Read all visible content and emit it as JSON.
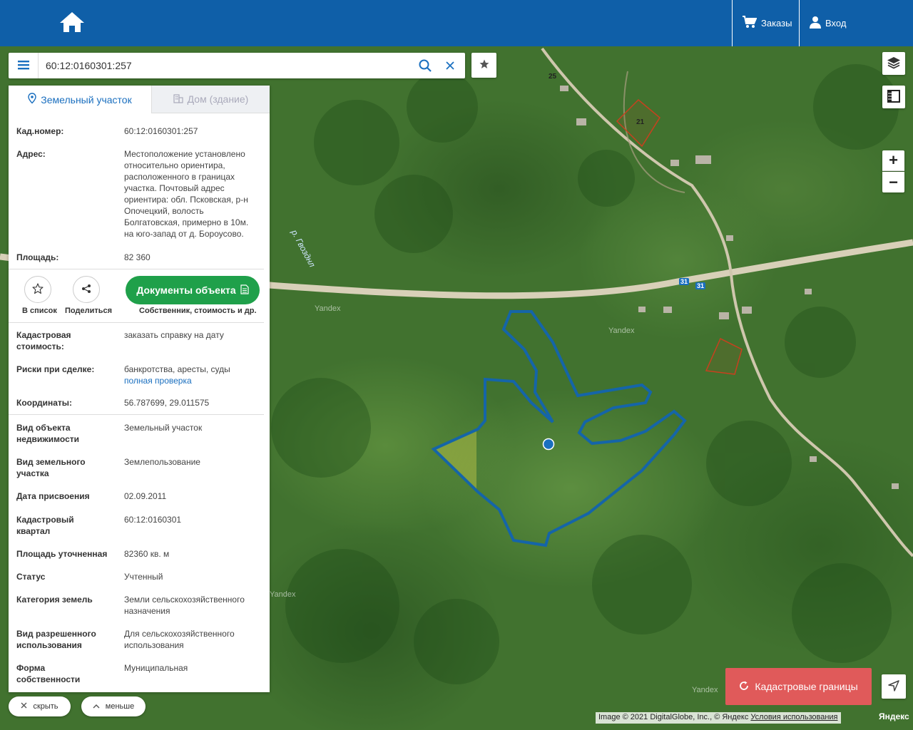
{
  "header": {
    "home_icon": "home-icon",
    "orders_label": "Заказы",
    "login_label": "Вход",
    "bg_color": "#0f5fa8"
  },
  "search": {
    "value": "60:12:0160301:257"
  },
  "panel": {
    "tabs": [
      {
        "label": "Земельный участок",
        "icon": "map-pin-icon",
        "active": true
      },
      {
        "label": "Дом (здание)",
        "icon": "building-icon",
        "active": false
      }
    ],
    "cad_number": {
      "label": "Кад.номер:",
      "value": "60:12:0160301:257"
    },
    "address": {
      "label": "Адрес:",
      "lines": [
        "Местоположение установлено",
        "относительно ориентира,",
        "расположенного в границах",
        "участка. Почтовый адрес",
        "ориентира: обл. Псковская, р-н",
        "Опочецкий, волость",
        "Болгатовская, примерно в 10м.",
        "на юго-запад от д. Бороусово."
      ]
    },
    "area": {
      "label": "Площадь:",
      "value": "82 360"
    },
    "actions": {
      "add_to_list": "В список",
      "share": "Поделиться",
      "documents": "Документы объекта",
      "documents_sub": "Собственник, стоимость и др."
    },
    "cad_cost": {
      "label_lines": [
        "Кадастровая",
        "стоимость:"
      ],
      "value": "заказать справку на дату"
    },
    "risks": {
      "label": "Риски при сделке:",
      "value": "банкротства, аресты, суды",
      "link": "полная проверка"
    },
    "coords": {
      "label": "Координаты:",
      "value": "56.787699, 29.011575"
    },
    "details": [
      {
        "label_lines": [
          "Вид объекта",
          "недвижимости"
        ],
        "value_lines": [
          "Земельный участок"
        ]
      },
      {
        "label_lines": [
          "Вид земельного",
          "участка"
        ],
        "value_lines": [
          "Землепользование"
        ]
      },
      {
        "label_lines": [
          "Дата присвоения"
        ],
        "value_lines": [
          "02.09.2011"
        ]
      },
      {
        "label_lines": [
          "Кадастровый",
          "квартал"
        ],
        "value_lines": [
          "60:12:0160301"
        ]
      },
      {
        "label_lines": [
          "Площадь уточненная"
        ],
        "value_lines": [
          "82360 кв. м"
        ]
      },
      {
        "label_lines": [
          "Статус"
        ],
        "value_lines": [
          "Учтенный"
        ]
      },
      {
        "label_lines": [
          "Категория земель"
        ],
        "value_lines": [
          "Земли сельскохозяйственного",
          "назначения"
        ]
      },
      {
        "label_lines": [
          "Вид разрешенного",
          "использования"
        ],
        "value_lines": [
          "Для сельскохозяйственного",
          "использования"
        ]
      },
      {
        "label_lines": [
          "Форма",
          "собственности"
        ],
        "value_lines": [
          "Муниципальная"
        ]
      }
    ]
  },
  "bottom": {
    "hide_label": "скрыть",
    "less_label": "меньше"
  },
  "map": {
    "river_label": "р. Гвозднл",
    "road_number": "31",
    "house_numbers": [
      "25",
      "21"
    ],
    "watermarks": [
      "Yandex",
      "Yandex",
      "Yandex",
      "Yandex"
    ],
    "cad_button": "Кадастровые границы",
    "attribution": "Image © 2021 DigitalGlobe, Inc., © Яндекс",
    "terms_link": "Условия использования",
    "yandex_logo": "Яндекс",
    "parcel_color": "#1565a8",
    "cad_button_color": "#e05a5a",
    "docs_button_color": "#1fa04a"
  }
}
